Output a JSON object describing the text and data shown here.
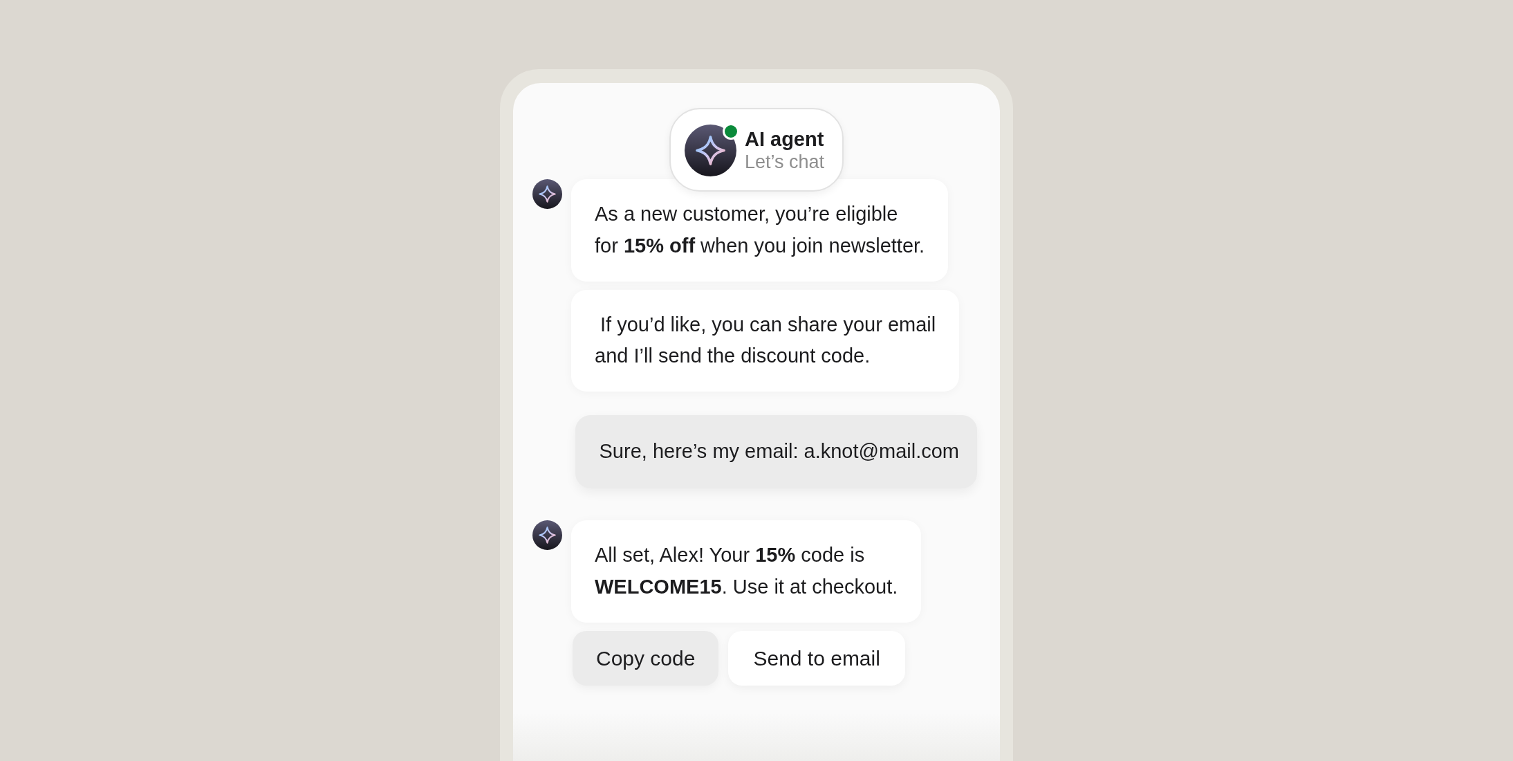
{
  "header": {
    "title": "AI agent",
    "subtitle": "Let’s chat",
    "online": true
  },
  "messages": [
    {
      "kind": "agent",
      "show_avatar": true,
      "text": "As a new customer, you’re eligible\nfor **15% off** when you join newsletter."
    },
    {
      "kind": "agent",
      "show_avatar": false,
      "text": " If you’d like, you can share your email\nand I’ll send the discount code."
    },
    {
      "kind": "user",
      "text": "Sure, here’s my email: a.knot@mail.com"
    },
    {
      "kind": "agent",
      "show_avatar": true,
      "text": "All set, Alex! Your **15%** code is\n**WELCOME15**. Use it at checkout."
    }
  ],
  "actions": [
    {
      "label": "Copy code",
      "kind": "tonal"
    },
    {
      "label": "Send to email",
      "kind": "plain"
    }
  ]
}
